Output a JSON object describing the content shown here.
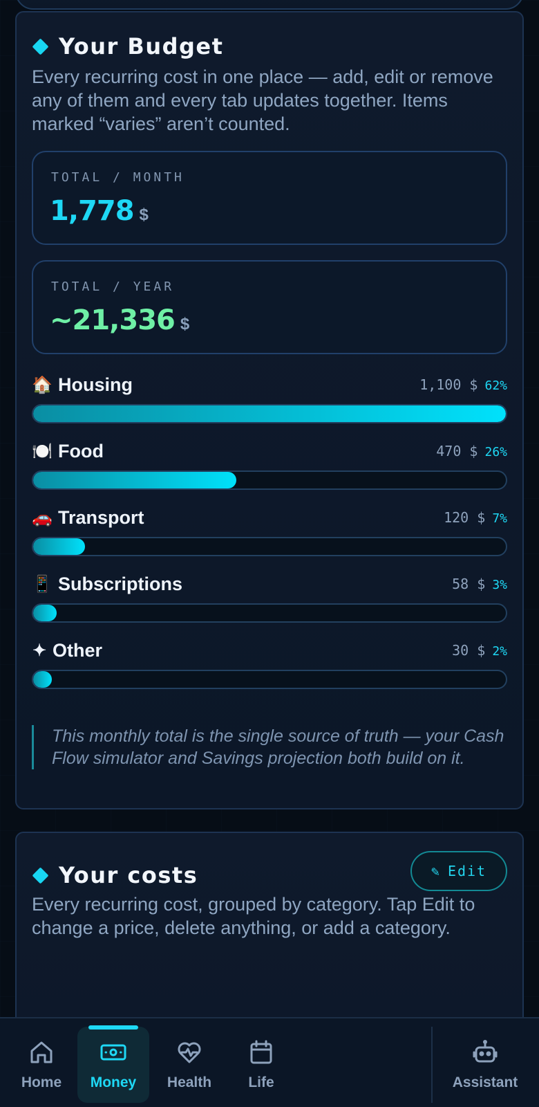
{
  "budget": {
    "title": "Your Budget",
    "description": "Every recurring cost in one place — add, edit or remove any of them and every tab updates together. Items marked “varies” aren’t counted.",
    "total_month": {
      "label": "TOTAL / MONTH",
      "value": "1,778",
      "unit": "$"
    },
    "total_year": {
      "label": "TOTAL / YEAR",
      "value": "~21,336",
      "unit": "$"
    },
    "categories": [
      {
        "icon": "🏠",
        "name": "Housing",
        "amount": "1,100 $",
        "percent": "62%",
        "fill": 1.0
      },
      {
        "icon": "🍽️",
        "name": "Food",
        "amount": "470 $",
        "percent": "26%",
        "fill": 0.43
      },
      {
        "icon": "🚗",
        "name": "Transport",
        "amount": "120 $",
        "percent": "7%",
        "fill": 0.11
      },
      {
        "icon": "📱",
        "name": "Subscriptions",
        "amount": "58 $",
        "percent": "3%",
        "fill": 0.05
      },
      {
        "icon": "✦",
        "name": "Other",
        "amount": "30 $",
        "percent": "2%",
        "fill": 0.03
      }
    ],
    "note": "This monthly total is the single source of truth — your Cash Flow simulator and Savings projection both build on it."
  },
  "costs": {
    "title": "Your costs",
    "description": "Every recurring cost, grouped by category. Tap Edit to change a price, delete anything, or add a category.",
    "edit_label": "Edit",
    "edit_icon": "✎"
  },
  "nav": {
    "items": [
      {
        "label": "Home",
        "icon": "home-icon"
      },
      {
        "label": "Money",
        "icon": "money-icon",
        "active": true
      },
      {
        "label": "Health",
        "icon": "heart-pulse-icon"
      },
      {
        "label": "Life",
        "icon": "calendar-icon"
      },
      {
        "label": "Assistant",
        "icon": "robot-icon"
      }
    ]
  },
  "colors": {
    "accent": "#1ed8f5",
    "year_total": "#6ff0a6",
    "background": "#060d16",
    "card": "#0f1a2c"
  }
}
